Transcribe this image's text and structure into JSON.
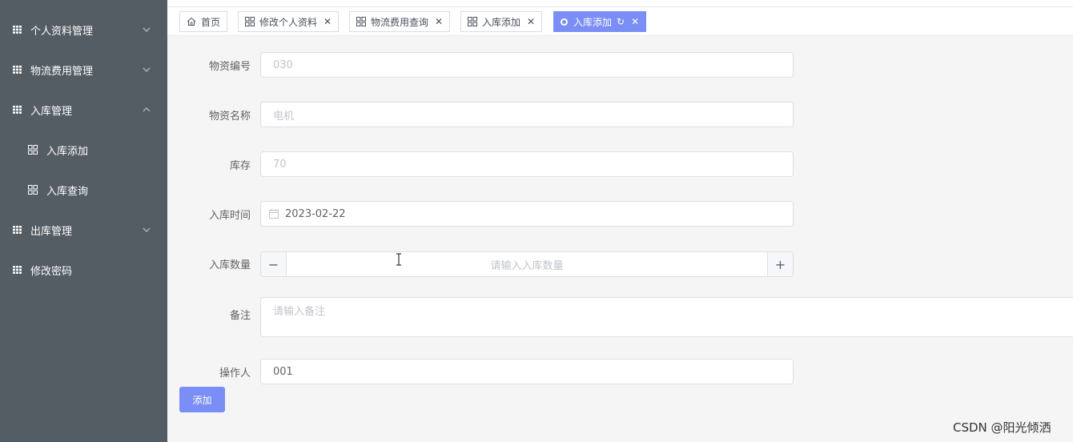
{
  "sidebar": {
    "items": [
      {
        "label": "个人资料管理",
        "chevron": "down"
      },
      {
        "label": "物流费用管理",
        "chevron": "down"
      },
      {
        "label": "入库管理",
        "chevron": "up"
      },
      {
        "label": "出库管理",
        "chevron": "down"
      },
      {
        "label": "修改密码"
      }
    ],
    "subitems": [
      {
        "label": "入库添加"
      },
      {
        "label": "入库查询"
      }
    ],
    "background": "#545c64"
  },
  "tabs": [
    {
      "label": "首页",
      "icon": "home-icon",
      "closable": false
    },
    {
      "label": "修改个人资料",
      "icon": "apps-icon",
      "closable": true
    },
    {
      "label": "物流费用查询",
      "icon": "apps-icon",
      "closable": true
    },
    {
      "label": "入库添加",
      "icon": "apps-icon",
      "closable": true
    },
    {
      "label": "入库添加",
      "icon": "dot-icon",
      "closable": true,
      "active": true
    }
  ],
  "form": {
    "material_code": {
      "label": "物资编号",
      "value": "030"
    },
    "material_name": {
      "label": "物资名称",
      "value": "电机"
    },
    "stock": {
      "label": "库存",
      "value": "70"
    },
    "inbound_time": {
      "label": "入库时间",
      "value": "2023-02-22"
    },
    "inbound_qty": {
      "label": "入库数量",
      "placeholder": "请输入入库数量",
      "dec": "−",
      "inc": "+"
    },
    "remark": {
      "label": "备注",
      "placeholder": "请输入备注"
    },
    "operator": {
      "label": "操作人",
      "value": "001"
    },
    "submit_label": "添加"
  },
  "watermark": "CSDN @阳光倾洒",
  "colors": {
    "accent": "#7b8ef5",
    "sidebar": "#545c64"
  }
}
